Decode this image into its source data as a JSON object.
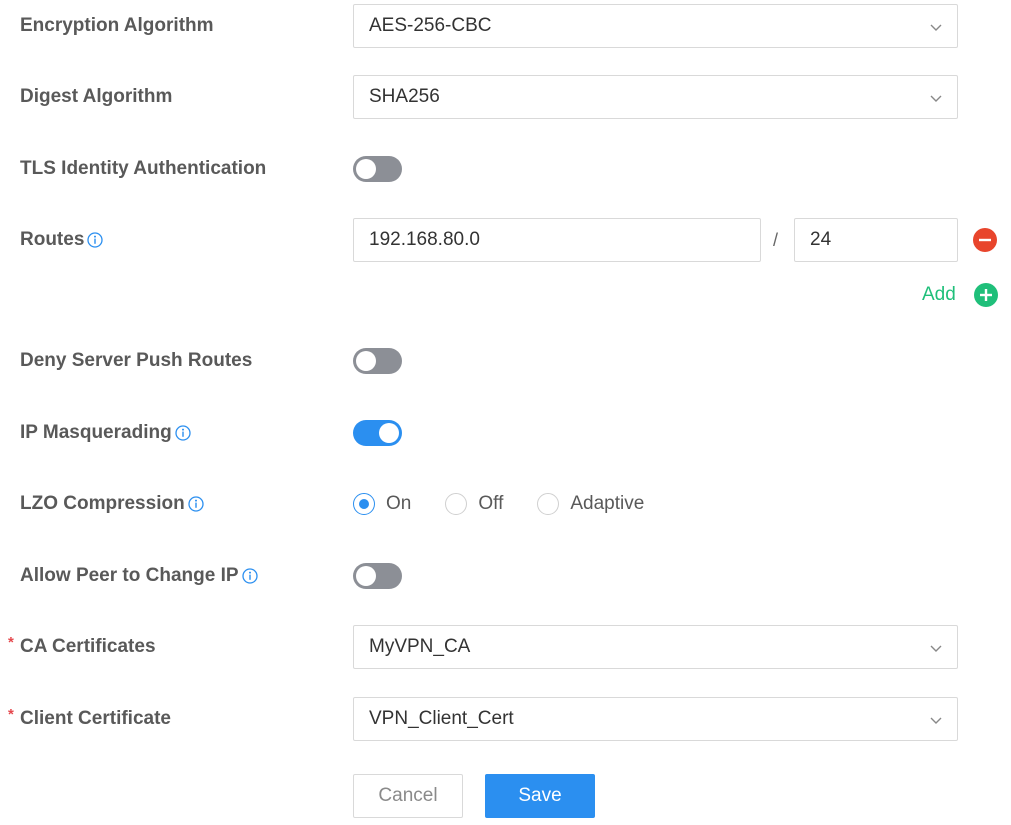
{
  "colors": {
    "primary": "#2b8ff0",
    "add_green": "#1fbf7a",
    "remove_red": "#e8452c",
    "switch_off": "#8c8f96",
    "required_star": "#e5484d"
  },
  "fields": {
    "encryption": {
      "label": "Encryption Algorithm",
      "value": "AES-256-CBC"
    },
    "digest": {
      "label": "Digest Algorithm",
      "value": "SHA256"
    },
    "tls_auth": {
      "label": "TLS Identity Authentication",
      "enabled": false
    },
    "routes": {
      "label": "Routes",
      "ip": "192.168.80.0",
      "separator": "/",
      "mask": "24",
      "add_label": "Add"
    },
    "deny_push": {
      "label": "Deny Server Push Routes",
      "enabled": false
    },
    "masquerading": {
      "label": "IP Masquerading",
      "enabled": true
    },
    "lzo": {
      "label": "LZO Compression",
      "options": [
        "On",
        "Off",
        "Adaptive"
      ],
      "selected": "On"
    },
    "peer_change_ip": {
      "label": "Allow Peer to Change IP",
      "enabled": false
    },
    "ca_cert": {
      "label": "CA Certificates",
      "required_mark": "*",
      "value": "MyVPN_CA"
    },
    "client_cert": {
      "label": "Client Certificate",
      "required_mark": "*",
      "value": "VPN_Client_Cert"
    }
  },
  "actions": {
    "cancel": "Cancel",
    "save": "Save"
  }
}
